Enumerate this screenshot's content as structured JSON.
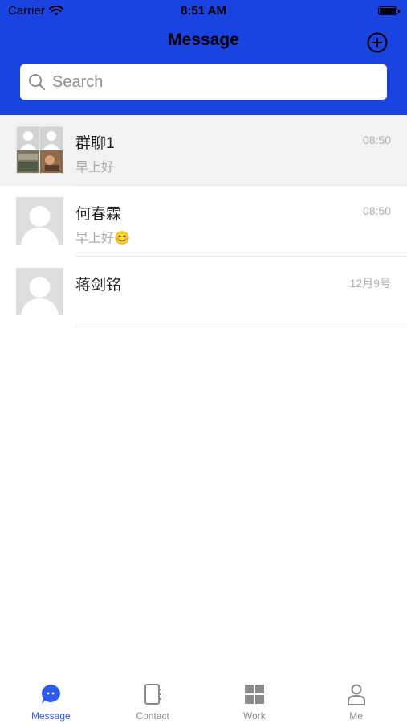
{
  "status_bar": {
    "carrier": "Carrier",
    "time": "8:51 AM"
  },
  "header": {
    "title": "Message",
    "add_icon": "plus-circle-icon"
  },
  "search": {
    "placeholder": "Search"
  },
  "conversations": [
    {
      "name": "群聊1",
      "preview": "早上好",
      "time": "08:50",
      "avatar": "group-avatar"
    },
    {
      "name": "何春霖",
      "preview": "早上好😊",
      "time": "08:50",
      "avatar": "default-avatar"
    },
    {
      "name": "蒋剑铭",
      "preview": "",
      "time": "12月9号",
      "avatar": "default-avatar"
    }
  ],
  "tabbar": [
    {
      "label": "Message",
      "icon": "chat-bubble-icon",
      "active": true
    },
    {
      "label": "Contact",
      "icon": "contact-book-icon",
      "active": false
    },
    {
      "label": "Work",
      "icon": "grid-icon",
      "active": false
    },
    {
      "label": "Me",
      "icon": "person-icon",
      "active": false
    }
  ],
  "colors": {
    "header_bg": "#1a43e0",
    "active_tab": "#2f5bea",
    "inactive_tab": "#8a8a8a",
    "time_text": "#b0b0b0"
  }
}
